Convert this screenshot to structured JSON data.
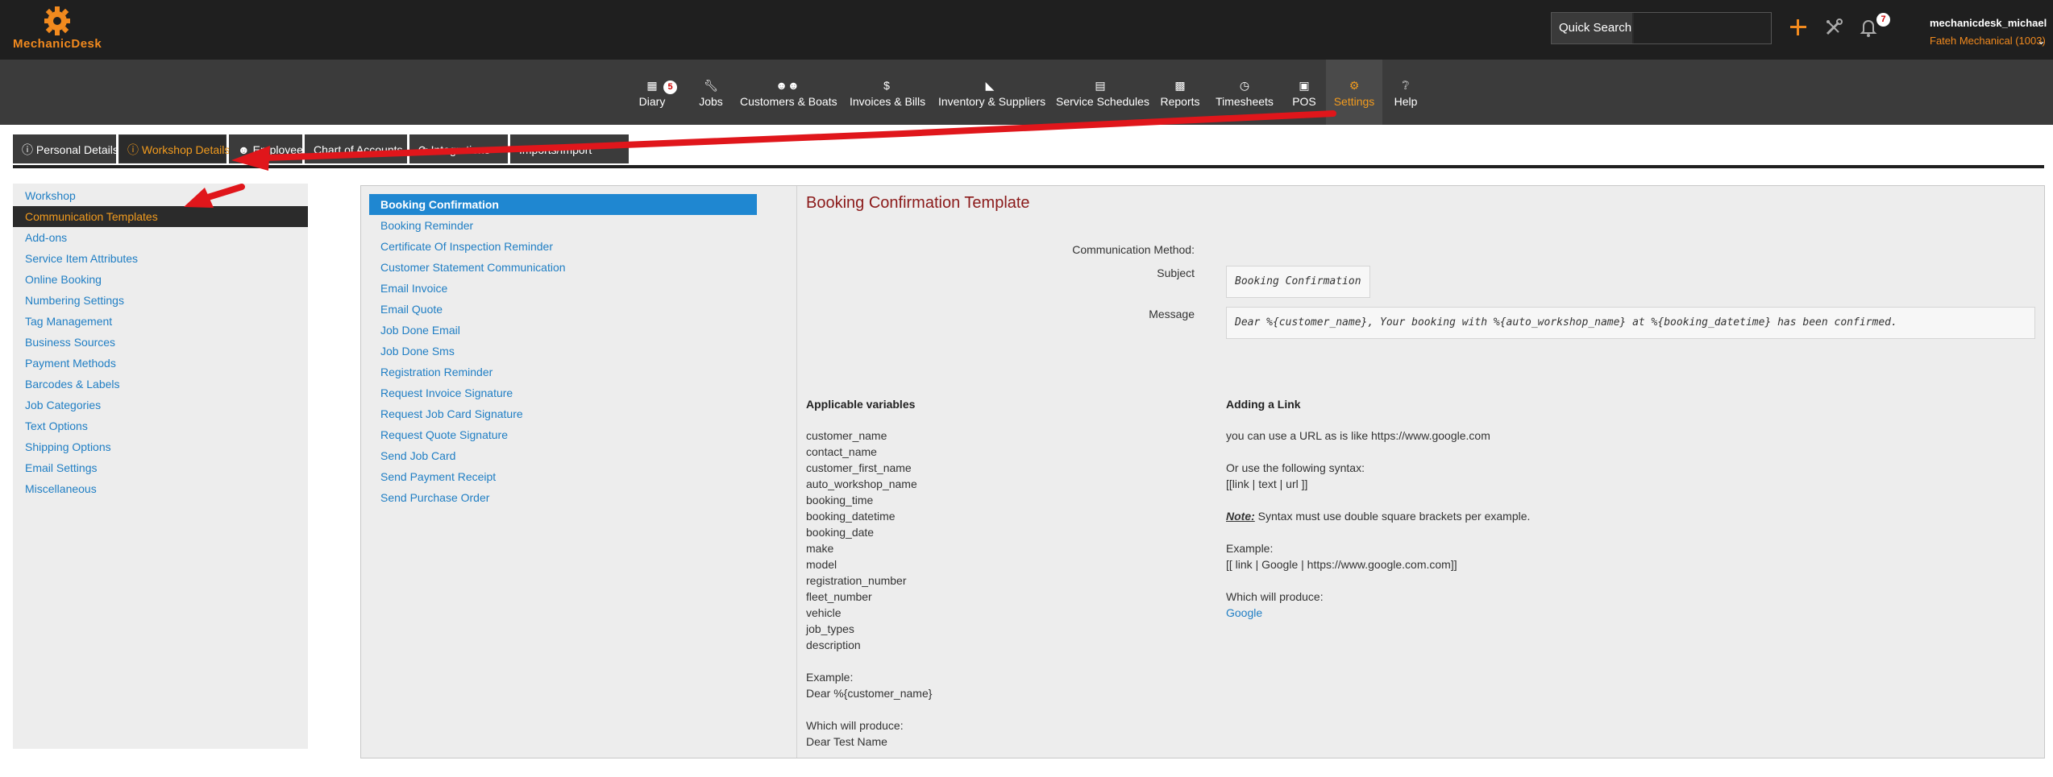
{
  "brand": {
    "name": "MechanicDesk",
    "color": "#f28a1e"
  },
  "topbar": {
    "quick_search_label": "Quick Search",
    "quick_search_value": "",
    "notifications_count": "7",
    "user_name": "mechanicdesk_michael",
    "workshop": "Fateh Mechanical (1003)"
  },
  "nav": {
    "items": [
      {
        "label": "Diary",
        "icon": "calendar-icon",
        "badge": "5"
      },
      {
        "label": "Jobs",
        "icon": "wrench-icon"
      },
      {
        "label": "Customers & Boats",
        "icon": "users-icon"
      },
      {
        "label": "Invoices & Bills",
        "icon": "dollar-icon"
      },
      {
        "label": "Inventory & Suppliers",
        "icon": "warehouse-icon"
      },
      {
        "label": "Service Schedules",
        "icon": "schedule-icon"
      },
      {
        "label": "Reports",
        "icon": "chart-icon"
      },
      {
        "label": "Timesheets",
        "icon": "clock-icon"
      },
      {
        "label": "POS",
        "icon": "store-icon"
      },
      {
        "label": "Settings",
        "icon": "gear-icon",
        "active": true
      },
      {
        "label": "Help",
        "icon": "question-icon"
      }
    ]
  },
  "subtabs": [
    {
      "label": "Personal Details",
      "icon": "info-icon"
    },
    {
      "label": "Workshop Details",
      "icon": "info-icon",
      "active": true
    },
    {
      "label": "Employees",
      "icon": "user-icon"
    },
    {
      "label": "Chart of Accounts"
    },
    {
      "label": "Integrations",
      "icon": "refresh-icon"
    },
    {
      "label": "Imports/Import"
    }
  ],
  "left_menu": [
    "Workshop",
    "Communication Templates",
    "Add-ons",
    "Service Item Attributes",
    "Online Booking",
    "Numbering Settings",
    "Tag Management",
    "Business Sources",
    "Payment Methods",
    "Barcodes & Labels",
    "Job Categories",
    "Text Options",
    "Shipping Options",
    "Email Settings",
    "Miscellaneous"
  ],
  "templates": [
    "Booking Confirmation",
    "Booking Reminder",
    "Certificate Of Inspection Reminder",
    "Customer Statement Communication",
    "Email Invoice",
    "Email Quote",
    "Job Done Email",
    "Job Done Sms",
    "Registration Reminder",
    "Request Invoice Signature",
    "Request Job Card Signature",
    "Request Quote Signature",
    "Send Job Card",
    "Send Payment Receipt",
    "Send Purchase Order"
  ],
  "template_detail": {
    "title": "Booking Confirmation Template",
    "communication_method_label": "Communication Method:",
    "subject_label": "Subject",
    "subject_value": "Booking Confirmation",
    "message_label": "Message",
    "message_value": "Dear %{customer_name}, Your booking with %{auto_workshop_name} at %{booking_datetime} has been confirmed."
  },
  "variables": {
    "heading": "Applicable variables",
    "list": [
      "customer_name",
      "contact_name",
      "customer_first_name",
      "auto_workshop_name",
      "booking_time",
      "booking_datetime",
      "booking_date",
      "make",
      "model",
      "registration_number",
      "fleet_number",
      "vehicle",
      "job_types",
      "description"
    ],
    "example_label": "Example:",
    "example_value": "Dear %{customer_name}",
    "produce_label": "Which will produce:",
    "produce_value": "Dear Test Name"
  },
  "adding_link": {
    "heading": "Adding a Link",
    "line1": "you can use a URL as is like https://www.google.com",
    "line2": "Or use the following syntax:",
    "line3": "[[link | text | url ]]",
    "note_label": "Note:",
    "note_text": " Syntax must use double square brackets per example.",
    "example_label": "Example:",
    "example_value": "[[ link | Google | https://www.google.com.com]]",
    "produce_label": "Which will produce:",
    "produce_link": "Google"
  },
  "colors": {
    "accent": "#f29b1e",
    "link": "#1f7ec4",
    "selected": "#1f87d1",
    "title": "#8b1a1a",
    "arrow": "#e0161b"
  }
}
